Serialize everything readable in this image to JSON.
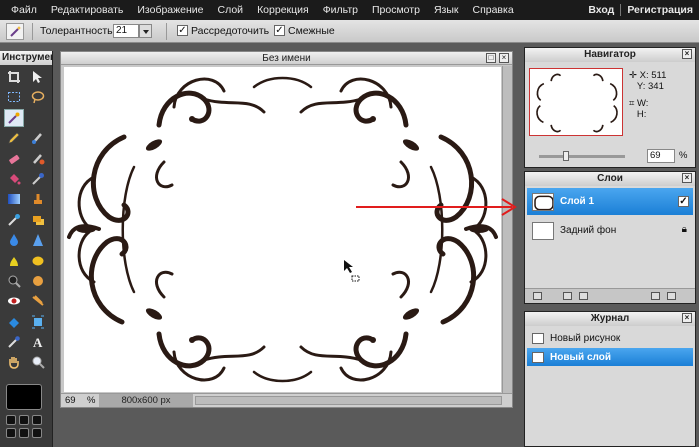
{
  "menubar": {
    "items": [
      "Файл",
      "Редактировать",
      "Изображение",
      "Слой",
      "Коррекция",
      "Фильтр",
      "Просмотр",
      "Язык",
      "Справка"
    ],
    "login": "Вход",
    "register": "Регистрация"
  },
  "options": {
    "tolerance_label": "Толерантность:",
    "tolerance_value": "21",
    "antialias_label": "Рассредоточить",
    "antialias_checked": true,
    "contiguous_label": "Смежные",
    "contiguous_checked": true
  },
  "tools": {
    "title": "Инструмент",
    "active": "magic-wand-tool",
    "foreground_color": "#000000"
  },
  "canvas": {
    "title": "Без имени",
    "zoom": "69",
    "zoom_unit": "%",
    "dimensions": "800x600 px"
  },
  "navigator": {
    "title": "Навигатор",
    "x_label": "X:",
    "x_value": "511",
    "y_label": "Y:",
    "y_value": "341",
    "w_label": "W:",
    "h_label": "H:",
    "zoom": "69",
    "zoom_unit": "%"
  },
  "layers": {
    "title": "Слои",
    "items": [
      {
        "name": "Слой 1",
        "selected": true
      },
      {
        "name": "Задний фон",
        "selected": false
      }
    ]
  },
  "history": {
    "title": "Журнал",
    "items": [
      {
        "name": "Новый рисунок",
        "selected": false
      },
      {
        "name": "Новый слой",
        "selected": true
      }
    ]
  },
  "colors": {
    "accent": "#1b7fd6",
    "menubar_bg": "#1b1b1b",
    "panel_bg": "#d9d9d9",
    "arrow": "#e11d1d",
    "ornament": "#2a1a14"
  }
}
